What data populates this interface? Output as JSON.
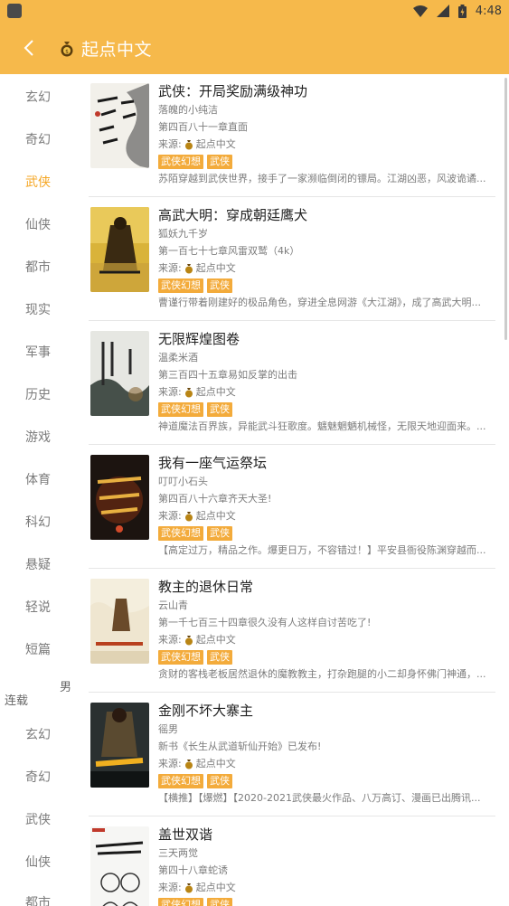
{
  "statusbar": {
    "time": "4:48"
  },
  "header": {
    "title": "起点中文",
    "back_icon": "chevron-left-icon",
    "logo_icon": "money-bag-icon"
  },
  "sidebar": {
    "categories": [
      "玄幻",
      "奇幻",
      "武侠",
      "仙侠",
      "都市",
      "现实",
      "军事",
      "历史",
      "游戏",
      "体育",
      "科幻",
      "悬疑",
      "轻说",
      "短篇"
    ],
    "active": "武侠",
    "group_male": "男",
    "group_serial": "连载",
    "categories2": [
      "玄幻",
      "奇幻",
      "武侠",
      "仙侠",
      "都市"
    ]
  },
  "books": [
    {
      "title": "武侠：开局奖励满级神功",
      "author": "落魄的小纯洁",
      "chapter": "第四百八十一章直面",
      "source_label": "来源:",
      "source": "起点中文",
      "tags": [
        "武侠幻想",
        "武侠"
      ],
      "desc": "苏陌穿越到武侠世界，接手了一家濒临倒闭的镖局。江湖凶恶，风波诡谲..."
    },
    {
      "title": "高武大明：穿成朝廷鹰犬",
      "author": "狐妖九千岁",
      "chapter": "第一百七十七章风雷双鹫（4k）",
      "source_label": "来源:",
      "source": "起点中文",
      "tags": [
        "武侠幻想",
        "武侠"
      ],
      "desc": "曹谨行带着刚建好的极品角色，穿进全息网游《大江湖》，成了高武大明..."
    },
    {
      "title": "无限辉煌图卷",
      "author": "温柔米酒",
      "chapter": "第三百四十五章易如反掌的出击",
      "source_label": "来源:",
      "source": "起点中文",
      "tags": [
        "武侠幻想",
        "武侠"
      ],
      "desc": "神道魔法百界族，异能武斗狂歌度。魑魅魍魉机械怪，无限天地迎面来。..."
    },
    {
      "title": "我有一座气运祭坛",
      "author": "叮叮小石头",
      "chapter": "第四百八十六章齐天大圣!",
      "source_label": "来源:",
      "source": "起点中文",
      "tags": [
        "武侠幻想",
        "武侠"
      ],
      "desc": "【高定过万，精品之作。爆更日万，不容错过！】平安县衙役陈渊穿越而..."
    },
    {
      "title": "教主的退休日常",
      "author": "云山青",
      "chapter": "第一千七百三十四章很久没有人这样自讨苦吃了!",
      "source_label": "来源:",
      "source": "起点中文",
      "tags": [
        "武侠幻想",
        "武侠"
      ],
      "desc": "贪财的客栈老板居然退休的魔教教主，打杂跑腿的小二却身怀佛门神通，..."
    },
    {
      "title": "金刚不坏大寨主",
      "author": "徭男",
      "chapter": "新书《长生从武道斩仙开始》已发布!",
      "source_label": "来源:",
      "source": "起点中文",
      "tags": [
        "武侠幻想",
        "武侠"
      ],
      "desc": "【横推】【爆燃】【2020-2021武侠最火作品、八万高订、漫画已出腾讯..."
    },
    {
      "title": "盖世双谐",
      "author": "三天两觉",
      "chapter": "第四十八章蛇诱",
      "source_label": "来源:",
      "source": "起点中文",
      "tags": [
        "武侠幻想",
        "武侠"
      ],
      "desc": ""
    }
  ],
  "colors": {
    "accent": "#f6b94b",
    "active": "#f5a623",
    "tag": "#f3ab3b"
  }
}
